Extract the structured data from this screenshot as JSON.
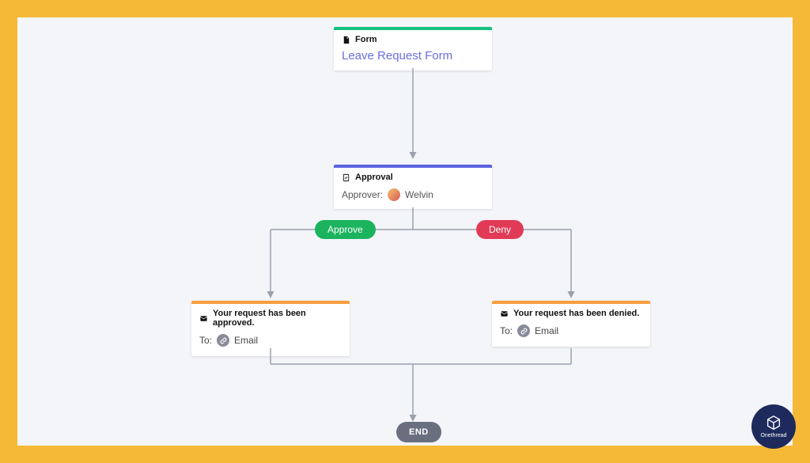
{
  "nodes": {
    "form": {
      "header": "Form",
      "title": "Leave Request Form",
      "bar_color": "#15c17e"
    },
    "approval": {
      "header": "Approval",
      "label_prefix": "Approver:",
      "approver_name": "Welvin",
      "bar_color": "#5b62e0"
    },
    "approved": {
      "message": "Your request has been approved.",
      "to_label": "To:",
      "channel": "Email",
      "bar_color": "#f79e3e"
    },
    "denied": {
      "message": "Your request has been denied.",
      "to_label": "To:",
      "channel": "Email",
      "bar_color": "#f79e3e"
    }
  },
  "branches": {
    "approve": "Approve",
    "deny": "Deny"
  },
  "end_label": "END",
  "brand": "Onethread",
  "colors": {
    "pill_approve": "#1cb35e",
    "pill_deny": "#e03a56",
    "end": "#6a6f80"
  }
}
